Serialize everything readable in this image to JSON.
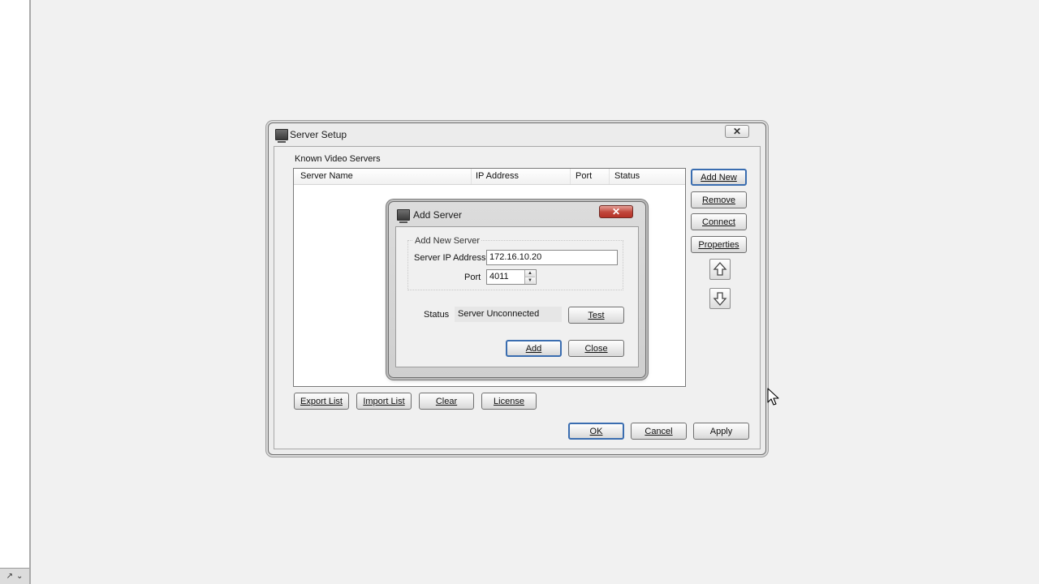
{
  "server_setup": {
    "title": "Server Setup",
    "known_servers_label": "Known Video Servers",
    "columns": [
      "Server Name",
      "IP Address",
      "Port",
      "Status"
    ],
    "side_buttons": {
      "add_new": "Add New",
      "remove": "Remove",
      "connect": "Connect",
      "properties": "Properties"
    },
    "list_buttons": {
      "export": "Export List",
      "import": "Import List",
      "clear": "Clear",
      "license": "License"
    },
    "dialog_buttons": {
      "ok": "OK",
      "cancel": "Cancel",
      "apply": "Apply"
    },
    "close_glyph": "✕"
  },
  "add_server": {
    "title": "Add Server",
    "group_label": "Add New Server",
    "ip_label": "Server IP Address",
    "ip_value": "172.16.10.20",
    "port_label": "Port",
    "port_value": "4011",
    "status_label": "Status",
    "status_value": "Server Unconnected",
    "test_button": "Test",
    "add_button": "Add",
    "close_button": "Close",
    "close_glyph": "✕"
  },
  "icons": {
    "move_up": "up-arrow-icon",
    "move_down": "down-arrow-icon",
    "window": "server-setup-icon",
    "cursor": "mouse-pointer-icon"
  },
  "taskbar_strip": {
    "glyph_a": "↗",
    "glyph_b": "⌄"
  }
}
